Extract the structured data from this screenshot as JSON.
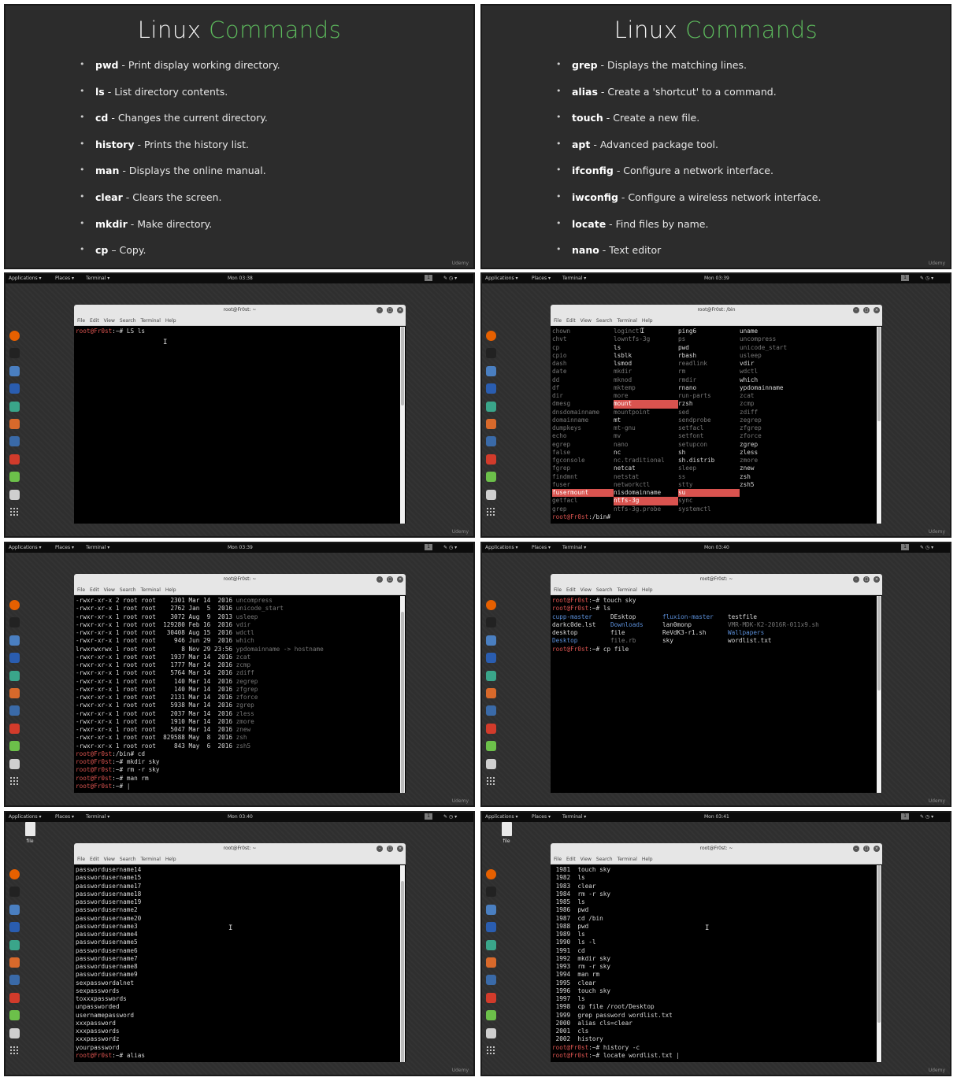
{
  "slides": [
    {
      "title_main": "Linux",
      "title_accent": "Commands",
      "items": [
        {
          "cmd": "pwd",
          "desc": " - Print  display working directory."
        },
        {
          "cmd": "ls",
          "desc": " - List directory contents."
        },
        {
          "cmd": "cd",
          "desc": " - Changes the current directory."
        },
        {
          "cmd": "history",
          "desc": " - Prints the history list."
        },
        {
          "cmd": "man",
          "desc": " - Displays the online manual."
        },
        {
          "cmd": "clear",
          "desc": " - Clears the screen."
        },
        {
          "cmd": "mkdir",
          "desc": " - Make directory."
        },
        {
          "cmd": "cp",
          "desc": " – Copy."
        }
      ],
      "watermark": "Udemy"
    },
    {
      "title_main": "Linux",
      "title_accent": "Commands",
      "items": [
        {
          "cmd": "grep",
          "desc": " - Displays the matching lines."
        },
        {
          "cmd": "alias",
          "desc": " - Create a 'shortcut' to a command."
        },
        {
          "cmd": "touch",
          "desc": " - Create a new file."
        },
        {
          "cmd": "apt",
          "desc": " - Advanced  package tool."
        },
        {
          "cmd": "ifconfig",
          "desc": " - Configure a network interface."
        },
        {
          "cmd": "iwconfig",
          "desc": " - Configure a wireless network interface."
        },
        {
          "cmd": "locate",
          "desc": " - Find files by name."
        },
        {
          "cmd": "nano",
          "desc": " - Text editor"
        }
      ],
      "watermark": "Udemy"
    }
  ],
  "topbar": {
    "applications": "Applications ▾",
    "places": "Places ▾",
    "terminal": "Terminal ▾",
    "workspace": "1",
    "status_icons": "✎ ◷ ▾"
  },
  "terminal_menu": [
    "File",
    "Edit",
    "View",
    "Search",
    "Terminal",
    "Help"
  ],
  "desktop_file_label": "file",
  "dock_icons": [
    {
      "name": "firefox-icon",
      "color": "#e66000"
    },
    {
      "name": "terminal-icon",
      "color": "#222222"
    },
    {
      "name": "files-icon",
      "color": "#4a7fc1"
    },
    {
      "name": "metasploit-icon",
      "color": "#2a5db0"
    },
    {
      "name": "armitage-icon",
      "color": "#3aa58a"
    },
    {
      "name": "burpsuite-icon",
      "color": "#d8692b"
    },
    {
      "name": "maltego-icon",
      "color": "#3a6aa8"
    },
    {
      "name": "faraday-icon",
      "color": "#d23b2b"
    },
    {
      "name": "leafpad-icon",
      "color": "#6cc04a"
    },
    {
      "name": "keyboard-icon",
      "color": "#cfcfcf"
    },
    {
      "name": "app-grid-icon",
      "color": "#555555"
    }
  ],
  "desktops": [
    {
      "clock": "Mon 03:38",
      "title": "root@Fr0st: ~",
      "prompt_user": "root@Fr0st",
      "prompt_path": ":~# ",
      "command": "LS ls",
      "watermark": "Udemy"
    },
    {
      "clock": "Mon 03:39",
      "title": "root@Fr0st: /bin",
      "columns": [
        [
          "chown",
          "chvt",
          "cp",
          "cpio",
          "dash",
          "date",
          "dd",
          "df",
          "dir",
          "dmesg",
          "dnsdomainname",
          "domainname",
          "dumpkeys",
          "echo",
          "egrep",
          "false",
          "fgconsole",
          "fgrep",
          "findmnt",
          "fuser",
          "fusermount",
          "getfacl",
          "grep"
        ],
        [
          "loginctl",
          "lowntfs-3g",
          "ls",
          "lsblk",
          "lsmod",
          "mkdir",
          "mknod",
          "mktemp",
          "more",
          "mount",
          "mountpoint",
          "mt",
          "mt-gnu",
          "mv",
          "nano",
          "nc",
          "nc.traditional",
          "netcat",
          "netstat",
          "networkctl",
          "nisdomainname",
          "ntfs-3g",
          "ntfs-3g.probe"
        ],
        [
          "ping6",
          "ps",
          "pwd",
          "rbash",
          "readlink",
          "rm",
          "rmdir",
          "rnano",
          "run-parts",
          "rzsh",
          "sed",
          "sendprobe",
          "setfacl",
          "setfont",
          "setupcon",
          "sh",
          "sh.distrib",
          "sleep",
          "ss",
          "stty",
          "su",
          "sync",
          "systemctl"
        ],
        [
          "uname",
          "uncompress",
          "unicode_start",
          "usleep",
          "vdir",
          "wdctl",
          "which",
          "ypdomainname",
          "zcat",
          "zcmp",
          "zdiff",
          "zegrep",
          "zfgrep",
          "zforce",
          "zgrep",
          "zless",
          "zmore",
          "znew",
          "zsh",
          "zsh5",
          "",
          "",
          ""
        ]
      ],
      "prompt_user": "root@Fr0st",
      "prompt_path": ":/bin# ",
      "watermark": "Udemy"
    },
    {
      "clock": "Mon 03:39",
      "title": "root@Fr0st: ~",
      "listing": [
        {
          "meta": "-rwxr-xr-x 2 root root    2301 Mar 14  2016 ",
          "name": "uncompress"
        },
        {
          "meta": "-rwxr-xr-x 1 root root    2762 Jan  5  2016 ",
          "name": "unicode_start"
        },
        {
          "meta": "-rwxr-xr-x 1 root root    3072 Aug  9  2013 ",
          "name": "usleep"
        },
        {
          "meta": "-rwxr-xr-x 1 root root  129280 Feb 16  2016 ",
          "name": "vdir"
        },
        {
          "meta": "-rwxr-xr-x 1 root root   30408 Aug 15  2016 ",
          "name": "wdctl"
        },
        {
          "meta": "-rwxr-xr-x 1 root root     946 Jun 29  2016 ",
          "name": "which"
        },
        {
          "meta": "lrwxrwxrwx 1 root root       8 Nov 29 23:56 ",
          "name": "ypdomainname -> hostname"
        },
        {
          "meta": "-rwxr-xr-x 1 root root    1937 Mar 14  2016 ",
          "name": "zcat"
        },
        {
          "meta": "-rwxr-xr-x 1 root root    1777 Mar 14  2016 ",
          "name": "zcmp"
        },
        {
          "meta": "-rwxr-xr-x 1 root root    5764 Mar 14  2016 ",
          "name": "zdiff"
        },
        {
          "meta": "-rwxr-xr-x 1 root root     140 Mar 14  2016 ",
          "name": "zegrep"
        },
        {
          "meta": "-rwxr-xr-x 1 root root     140 Mar 14  2016 ",
          "name": "zfgrep"
        },
        {
          "meta": "-rwxr-xr-x 1 root root    2131 Mar 14  2016 ",
          "name": "zforce"
        },
        {
          "meta": "-rwxr-xr-x 1 root root    5938 Mar 14  2016 ",
          "name": "zgrep"
        },
        {
          "meta": "-rwxr-xr-x 1 root root    2037 Mar 14  2016 ",
          "name": "zless"
        },
        {
          "meta": "-rwxr-xr-x 1 root root    1910 Mar 14  2016 ",
          "name": "zmore"
        },
        {
          "meta": "-rwxr-xr-x 1 root root    5047 Mar 14  2016 ",
          "name": "znew"
        },
        {
          "meta": "-rwxr-xr-x 1 root root  829588 May  8  2016 ",
          "name": "zsh"
        },
        {
          "meta": "-rwxr-xr-x 1 root root     843 May  6  2016 ",
          "name": "zsh5"
        }
      ],
      "commands": [
        {
          "user": "root@Fr0st",
          "path": ":/bin# ",
          "cmd": "cd"
        },
        {
          "user": "root@Fr0st",
          "path": ":~# ",
          "cmd": "mkdir sky"
        },
        {
          "user": "root@Fr0st",
          "path": ":~# ",
          "cmd": "rm -r sky"
        },
        {
          "user": "root@Fr0st",
          "path": ":~# ",
          "cmd": "man rm"
        },
        {
          "user": "root@Fr0st",
          "path": ":~# ",
          "cmd": "|"
        }
      ],
      "watermark": "Udemy"
    },
    {
      "clock": "Mon 03:40",
      "title": "root@Fr0st: ~",
      "commands": [
        {
          "user": "root@Fr0st",
          "path": ":~# ",
          "cmd": "touch sky"
        },
        {
          "user": "root@Fr0st",
          "path": ":~# ",
          "cmd": "ls"
        }
      ],
      "ls_rows": [
        [
          {
            "t": "cupp-master",
            "c": "pp"
          },
          {
            "t": "DEsktop",
            "c": ""
          },
          {
            "t": "fluxion-master",
            "c": "pp"
          },
          {
            "t": "testfile",
            "c": ""
          }
        ],
        [
          {
            "t": "darkc0de.lst",
            "c": ""
          },
          {
            "t": "Downloads",
            "c": "pp"
          },
          {
            "t": "lan0monp",
            "c": ""
          },
          {
            "t": "VMR-MDK-K2-2016R-011x9.sh",
            "c": "dim"
          }
        ],
        [
          {
            "t": "desktop",
            "c": ""
          },
          {
            "t": "file",
            "c": ""
          },
          {
            "t": "ReVdK3-r1.sh",
            "c": ""
          },
          {
            "t": "Wallpapers",
            "c": "pp"
          }
        ],
        [
          {
            "t": "Desktop",
            "c": "pp"
          },
          {
            "t": "file.rb",
            "c": "dim"
          },
          {
            "t": "sky",
            "c": ""
          },
          {
            "t": "wordlist.txt",
            "c": ""
          }
        ]
      ],
      "last": {
        "user": "root@Fr0st",
        "path": ":~# ",
        "cmd": "cp file"
      },
      "watermark": "Udemy"
    },
    {
      "clock": "Mon 03:40",
      "title": "root@Fr0st: ~",
      "lines": [
        "passwordusername14",
        "passwordusername15",
        "passwordusername17",
        "passwordusername18",
        "passwordusername19",
        "passwordusername2",
        "passwordusername20",
        "passwordusername3",
        "passwordusername4",
        "passwordusername5",
        "passwordusername6",
        "passwordusername7",
        "passwordusername8",
        "passwordusername9",
        "sexpasswordalnet",
        "sexpasswords",
        "toxxxpasswords",
        "unpassworded",
        "usernamepassword",
        "xxxpassword",
        "xxxpasswords",
        "xxxpasswordz",
        "yourpassword"
      ],
      "last": {
        "user": "root@Fr0st",
        "path": ":~# ",
        "cmd": "alias"
      },
      "watermark": "Udemy"
    },
    {
      "clock": "Mon 03:41",
      "title": "root@Fr0st: ~",
      "history": [
        " 1981  touch sky",
        " 1982  ls",
        " 1983  clear",
        " 1984  rm -r sky",
        " 1985  ls",
        " 1986  pwd",
        " 1987  cd /bin",
        " 1988  pwd",
        " 1989  ls",
        " 1990  ls -l",
        " 1991  cd",
        " 1992  mkdir sky",
        " 1993  rm -r sky",
        " 1994  man rm",
        " 1995  clear",
        " 1996  touch sky",
        " 1997  ls",
        " 1998  cp file /root/Desktop",
        " 1999  grep password wordlist.txt",
        " 2000  alias cls=clear",
        " 2001  cls",
        " 2002  history"
      ],
      "commands": [
        {
          "user": "root@Fr0st",
          "path": ":~# ",
          "cmd": "history -c"
        },
        {
          "user": "root@Fr0st",
          "path": ":~# ",
          "cmd": "locate wordlist.txt |"
        }
      ],
      "watermark": "Udemy"
    }
  ]
}
